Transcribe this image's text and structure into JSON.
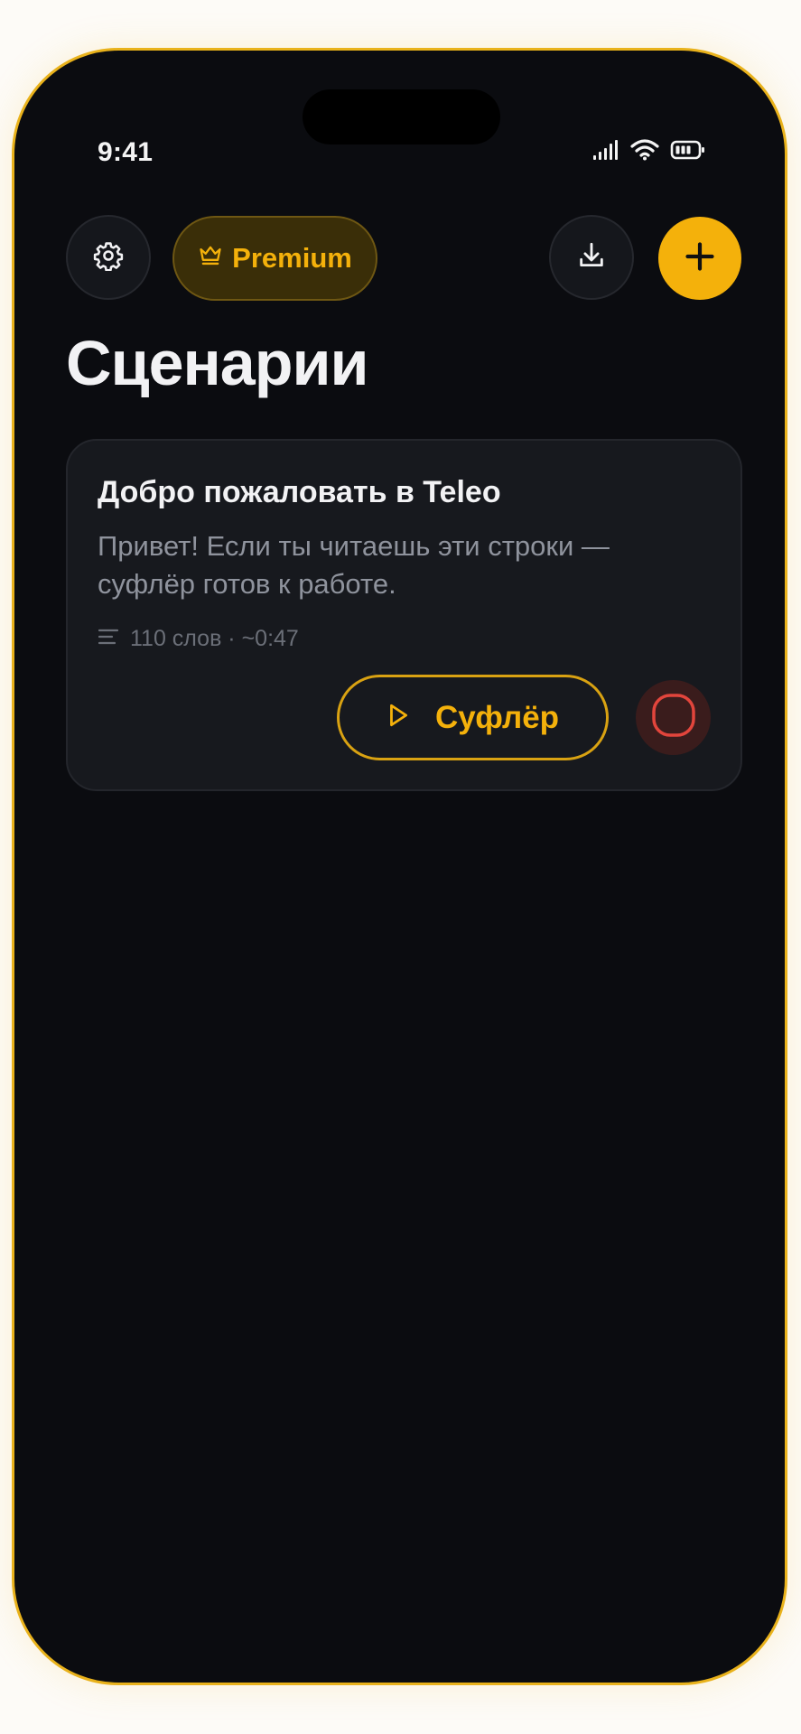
{
  "status_bar": {
    "time": "9:41",
    "icons": [
      "cellular-signal-icon",
      "wifi-icon",
      "battery-icon"
    ]
  },
  "toolbar": {
    "settings_icon": "gear-icon",
    "premium_label": "Premium",
    "premium_icon": "crown-icon",
    "download_icon": "download-icon",
    "add_icon": "plus-icon"
  },
  "page": {
    "title": "Сценарии"
  },
  "scripts": [
    {
      "title": "Добро пожаловать в Teleo",
      "preview": "Привет! Если ты читаешь эти строки — суфлёр готов к работе.",
      "meta": "110 слов · ~0:47",
      "meta_icon": "text-lines-icon",
      "prompter_label": "Суфлёр",
      "prompter_icon": "play-icon",
      "record_icon": "record-icon"
    }
  ],
  "colors": {
    "accent": "#f4b10b",
    "background": "#0b0c10",
    "card": "#17191e",
    "record": "#e2453c",
    "frame": "#e9b21b"
  }
}
